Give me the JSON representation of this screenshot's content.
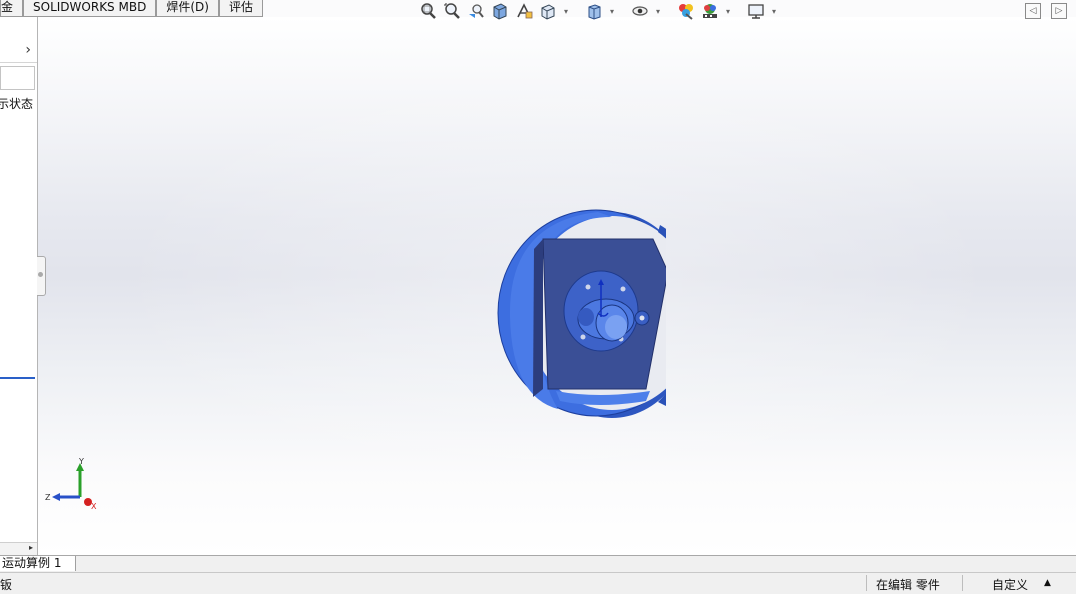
{
  "tabs": [
    "金",
    "SOLIDWORKS MBD",
    "焊件(D)",
    "评估"
  ],
  "left_panel": {
    "chevron": "›",
    "display_state_label": "示状态"
  },
  "bottom_tab": "运动算例 1",
  "status": {
    "left": "钣",
    "editing": "在编辑 零件",
    "custom": "自定义",
    "arrow": "▲"
  },
  "hud_icons": [
    "zoom-to-fit-icon",
    "zoom-to-area-icon",
    "previous-view-icon",
    "section-view-icon",
    "dynamic-annotation-icon",
    "view-orientation-icon",
    "display-style-icon",
    "hide-show-icon",
    "edit-appearance-icon",
    "apply-scene-icon",
    "view-settings-icon"
  ],
  "triad": {
    "x": "X",
    "y": "Y",
    "z": "Z"
  },
  "colors": {
    "model_blue": "#3f6fdd",
    "plate": "#3b5299",
    "y_axis": "#2aa02a",
    "x_axis": "#d42020",
    "z_axis": "#2850c8"
  }
}
